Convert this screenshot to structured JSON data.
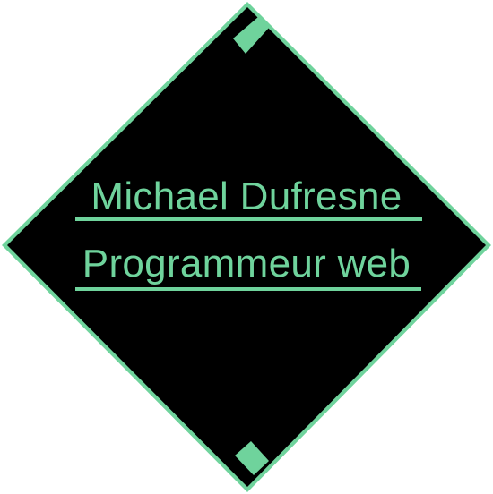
{
  "profile": {
    "name": "Michael Dufresne",
    "role": "Programmeur web"
  },
  "colors": {
    "accent": "#6fd39c",
    "background": "#000000",
    "page": "#ffffff"
  }
}
